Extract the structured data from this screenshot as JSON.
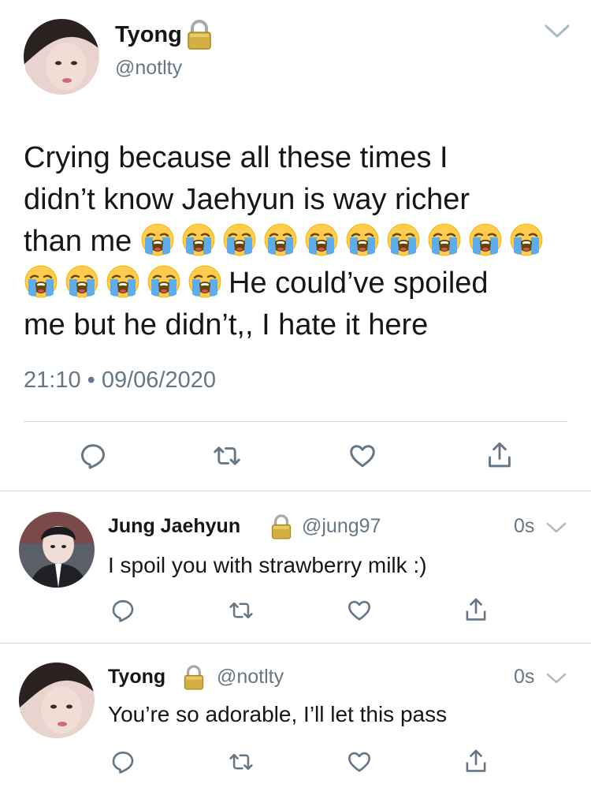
{
  "main_tweet": {
    "author_name": "Tyong",
    "author_handle": "@notlty",
    "text_line1": "Crying because all these times I",
    "text_line2": "didn’t know Jaehyun is way richer",
    "text_line3": "than me",
    "text_line4_suffix": "He could’ve spoiled",
    "text_line5": "me but he didn’t,, I hate it here",
    "emoji_icon": "loudly-crying-face-icon",
    "emoji_count_line3": 10,
    "emoji_count_line4": 5,
    "time": "21:10",
    "dot": "•",
    "date": "09/06/2020",
    "actions": [
      "reply-icon",
      "retweet-icon",
      "like-icon",
      "share-icon"
    ]
  },
  "replies": [
    {
      "author_name": "Jung Jaehyun",
      "author_handle": "@jung97",
      "time": "0s",
      "text": "I spoil you with strawberry milk :)"
    },
    {
      "author_name": "Tyong",
      "author_handle": "@notlty",
      "time": "0s",
      "text": "You’re so adorable, I’ll let this pass"
    }
  ],
  "colors": {
    "text": "#14171a",
    "secondary": "#657786",
    "divider": "#cfd6dc",
    "icon": "#657786",
    "lock": "#c9a227"
  }
}
